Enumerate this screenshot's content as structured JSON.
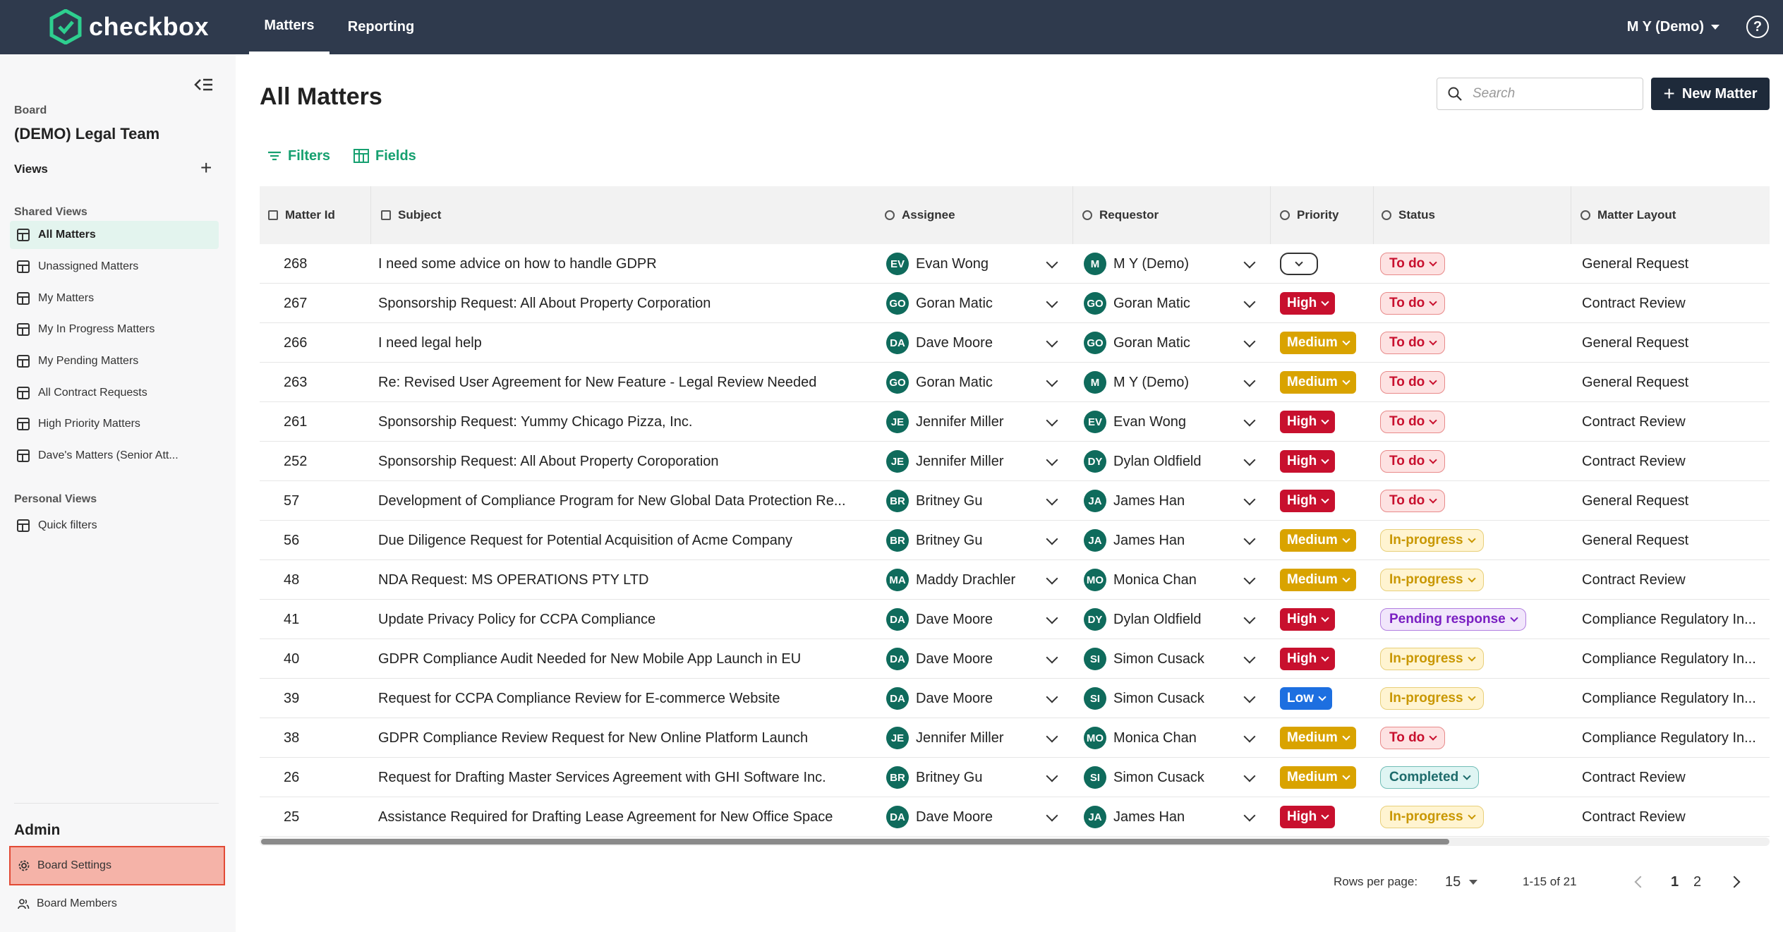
{
  "app": {
    "name": "checkbox"
  },
  "nav": {
    "tabs": [
      "Matters",
      "Reporting"
    ],
    "active": "Matters",
    "user": "M Y (Demo)"
  },
  "sidebar": {
    "board_caption": "Board",
    "board_name": "(DEMO) Legal Team",
    "views_label": "Views",
    "shared_caption": "Shared Views",
    "shared_views": [
      "All Matters",
      "Unassigned Matters",
      "My Matters",
      "My In Progress Matters",
      "My Pending Matters",
      "All Contract Requests",
      "High Priority Matters",
      "Dave's Matters (Senior Att..."
    ],
    "personal_caption": "Personal Views",
    "personal_views": [
      "Quick filters"
    ],
    "admin_label": "Admin",
    "board_settings": "Board Settings",
    "board_members": "Board Members"
  },
  "main": {
    "title": "All Matters",
    "search_placeholder": "Search",
    "new_matter_label": "New Matter",
    "filters_label": "Filters",
    "fields_label": "Fields"
  },
  "table": {
    "columns": [
      "Matter Id",
      "Subject",
      "Assignee",
      "Requestor",
      "Priority",
      "Status",
      "Matter Layout"
    ],
    "rows": [
      {
        "id": "268",
        "subject": "I need some advice on how to handle GDPR",
        "assignee": "Evan Wong",
        "assignee_initials": "EV",
        "requestor": "M Y (Demo)",
        "requestor_initials": "M",
        "priority": "",
        "status": "To do",
        "layout": "General Request"
      },
      {
        "id": "267",
        "subject": "Sponsorship Request: All About Property Corporation",
        "assignee": "Goran Matic",
        "assignee_initials": "GO",
        "requestor": "Goran Matic",
        "requestor_initials": "GO",
        "priority": "High",
        "status": "To do",
        "layout": "Contract Review"
      },
      {
        "id": "266",
        "subject": "I need legal help",
        "assignee": "Dave Moore",
        "assignee_initials": "DA",
        "requestor": "Goran Matic",
        "requestor_initials": "GO",
        "priority": "Medium",
        "status": "To do",
        "layout": "General Request"
      },
      {
        "id": "263",
        "subject": "Re: Revised User Agreement for New Feature - Legal Review Needed",
        "assignee": "Goran Matic",
        "assignee_initials": "GO",
        "requestor": "M Y (Demo)",
        "requestor_initials": "M",
        "priority": "Medium",
        "status": "To do",
        "layout": "General Request"
      },
      {
        "id": "261",
        "subject": "Sponsorship Request: Yummy Chicago Pizza, Inc.",
        "assignee": "Jennifer Miller",
        "assignee_initials": "JE",
        "requestor": "Evan Wong",
        "requestor_initials": "EV",
        "priority": "High",
        "status": "To do",
        "layout": "Contract Review"
      },
      {
        "id": "252",
        "subject": "Sponsorship Request: All About Property Coroporation",
        "assignee": "Jennifer Miller",
        "assignee_initials": "JE",
        "requestor": "Dylan Oldfield",
        "requestor_initials": "DY",
        "priority": "High",
        "status": "To do",
        "layout": "Contract Review"
      },
      {
        "id": "57",
        "subject": "Development of Compliance Program for New Global Data Protection Re...",
        "assignee": "Britney Gu",
        "assignee_initials": "BR",
        "requestor": "James Han",
        "requestor_initials": "JA",
        "priority": "High",
        "status": "To do",
        "layout": "General Request"
      },
      {
        "id": "56",
        "subject": "Due Diligence Request for Potential Acquisition of Acme Company",
        "assignee": "Britney Gu",
        "assignee_initials": "BR",
        "requestor": "James Han",
        "requestor_initials": "JA",
        "priority": "Medium",
        "status": "In-progress",
        "layout": "General Request"
      },
      {
        "id": "48",
        "subject": "NDA Request: MS OPERATIONS PTY LTD",
        "assignee": "Maddy Drachler",
        "assignee_initials": "MA",
        "requestor": "Monica Chan",
        "requestor_initials": "MO",
        "priority": "Medium",
        "status": "In-progress",
        "layout": "Contract Review"
      },
      {
        "id": "41",
        "subject": "Update Privacy Policy for CCPA Compliance",
        "assignee": "Dave Moore",
        "assignee_initials": "DA",
        "requestor": "Dylan Oldfield",
        "requestor_initials": "DY",
        "priority": "High",
        "status": "Pending response",
        "layout": "Compliance Regulatory In..."
      },
      {
        "id": "40",
        "subject": "GDPR Compliance Audit Needed for New Mobile App Launch in EU",
        "assignee": "Dave Moore",
        "assignee_initials": "DA",
        "requestor": "Simon Cusack",
        "requestor_initials": "SI",
        "priority": "High",
        "status": "In-progress",
        "layout": "Compliance Regulatory In..."
      },
      {
        "id": "39",
        "subject": "Request for CCPA Compliance Review for E-commerce Website",
        "assignee": "Dave Moore",
        "assignee_initials": "DA",
        "requestor": "Simon Cusack",
        "requestor_initials": "SI",
        "priority": "Low",
        "status": "In-progress",
        "layout": "Compliance Regulatory In..."
      },
      {
        "id": "38",
        "subject": "GDPR Compliance Review Request for New Online Platform Launch",
        "assignee": "Jennifer Miller",
        "assignee_initials": "JE",
        "requestor": "Monica Chan",
        "requestor_initials": "MO",
        "priority": "Medium",
        "status": "To do",
        "layout": "Compliance Regulatory In..."
      },
      {
        "id": "26",
        "subject": "Request for Drafting Master Services Agreement with GHI Software Inc.",
        "assignee": "Britney Gu",
        "assignee_initials": "BR",
        "requestor": "Simon Cusack",
        "requestor_initials": "SI",
        "priority": "Medium",
        "status": "Completed",
        "layout": "Contract Review"
      },
      {
        "id": "25",
        "subject": "Assistance Required for Drafting Lease Agreement for New Office Space",
        "assignee": "Dave Moore",
        "assignee_initials": "DA",
        "requestor": "James Han",
        "requestor_initials": "JA",
        "priority": "High",
        "status": "In-progress",
        "layout": "Contract Review"
      }
    ]
  },
  "pagination": {
    "rows_per_page_label": "Rows per page:",
    "rows_per_page": "15",
    "range": "1-15 of 21",
    "pages": [
      "1",
      "2"
    ],
    "current_page": "1"
  },
  "colors": {
    "topbar": "#2f3a4d",
    "accent_green": "#16a070",
    "avatar": "#0f6b5c",
    "priority": {
      "High": {
        "bg": "#c8102e",
        "fg": "#ffffff"
      },
      "Medium": {
        "bg": "#d9a300",
        "fg": "#ffffff"
      },
      "Low": {
        "bg": "#1d6fe0",
        "fg": "#ffffff"
      }
    },
    "status": {
      "To do": {
        "bg": "#fde2e2",
        "fg": "#c8102e",
        "border": "#e88a8a"
      },
      "In-progress": {
        "bg": "#fff4d1",
        "fg": "#c99700",
        "border": "#e8cf7a"
      },
      "Pending response": {
        "bg": "#f1e6fb",
        "fg": "#7a1fc2",
        "border": "#b27fe0"
      },
      "Completed": {
        "bg": "#dff5f3",
        "fg": "#1d6b6b",
        "border": "#72bdb7"
      }
    }
  }
}
